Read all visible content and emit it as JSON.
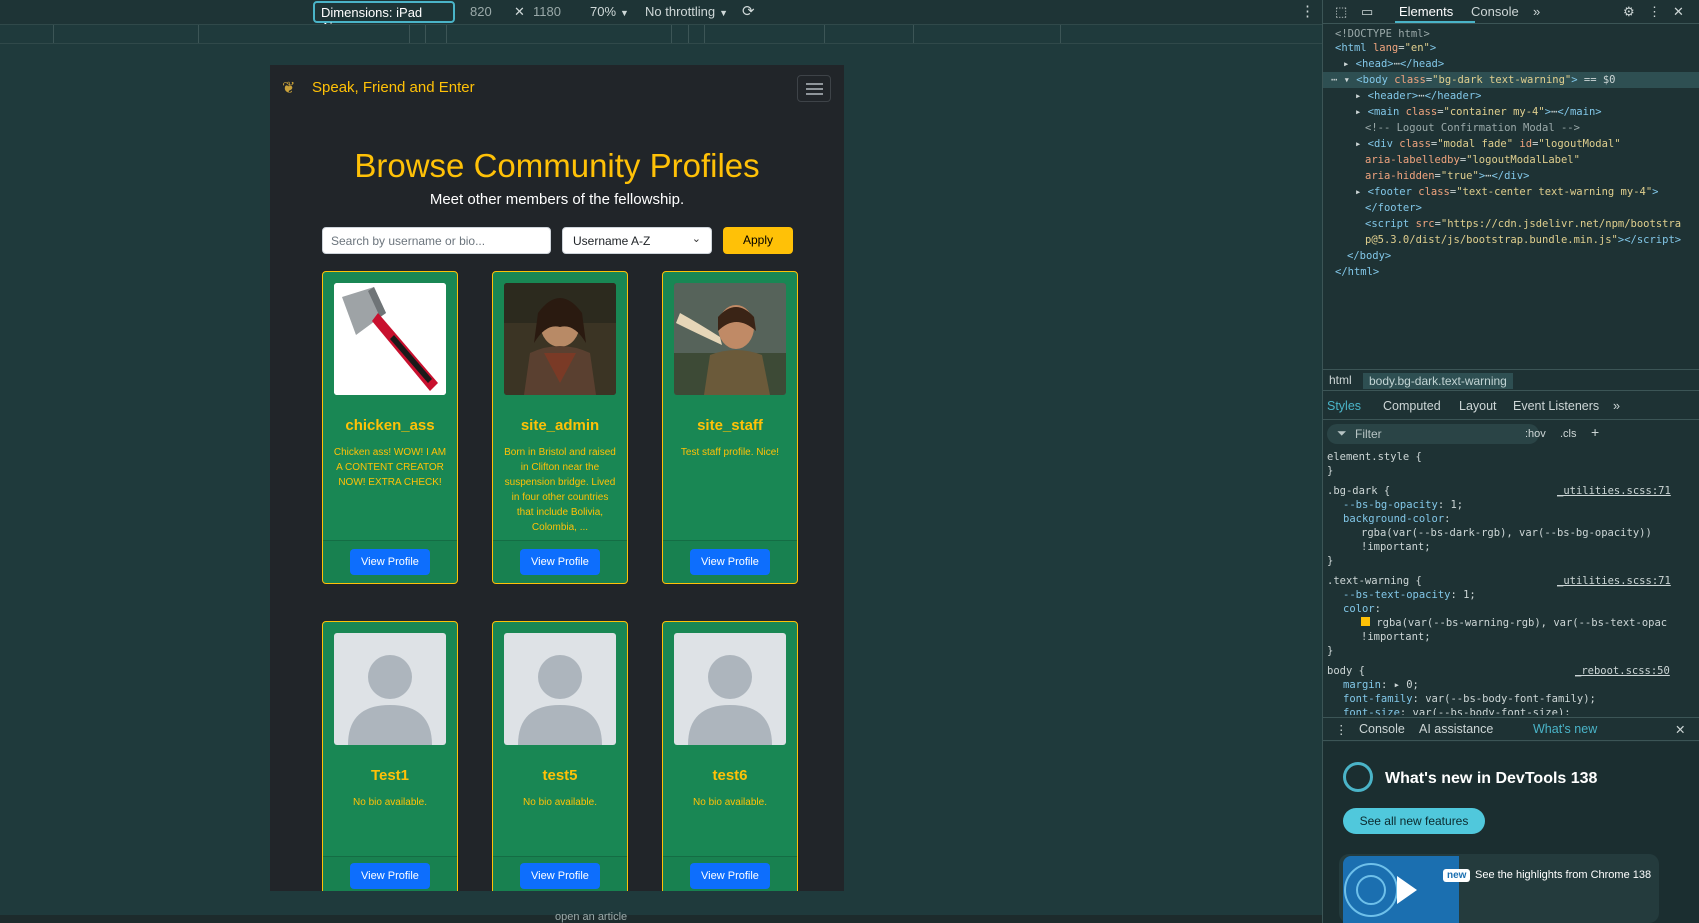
{
  "devtools_toolbar": {
    "dimensions": "Dimensions: iPad Air",
    "width": "820",
    "height": "1180",
    "zoom": "70%",
    "throttling": "No throttling"
  },
  "site": {
    "brand": "Speak, Friend and Enter",
    "title": "Browse Community Profiles",
    "subtitle": "Meet other members of the fellowship.",
    "search_placeholder": "Search by username or bio...",
    "sort_value": "Username A-Z",
    "apply_label": "Apply",
    "view_label": "View Profile",
    "profiles": [
      {
        "username": "chicken_ass",
        "bio": "Chicken ass! WOW! I AM A CONTENT CREATOR NOW! EXTRA CHECK!"
      },
      {
        "username": "site_admin",
        "bio": "Born in Bristol and raised in Clifton near the suspension bridge. Lived in four other countries that include Bolivia, Colombia, ..."
      },
      {
        "username": "site_staff",
        "bio": "Test staff profile. Nice!"
      },
      {
        "username": "Test1",
        "bio": "No bio available."
      },
      {
        "username": "test5",
        "bio": "No bio available."
      },
      {
        "username": "test6",
        "bio": "No bio available."
      }
    ]
  },
  "devtools": {
    "tabs": [
      "Elements",
      "Console"
    ],
    "breadcrumbs": [
      "html",
      "body.bg-dark.text-warning"
    ],
    "style_tabs": [
      "Styles",
      "Computed",
      "Layout",
      "Event Listeners"
    ],
    "filter_placeholder": "Filter",
    "filter_hov": ":hov",
    "filter_cls": ".cls",
    "drawer_tabs": [
      "Console",
      "AI assistance",
      "What's new"
    ],
    "whatsnew_title": "What's new in DevTools 138",
    "whatsnew_button": "See all new features",
    "whatsnew_card_text": "See the highlights from Chrome 138",
    "whatsnew_badge": "new",
    "bottom_peek": "open an article"
  },
  "colors": {
    "accent": "#ffc107",
    "card": "#198754",
    "button": "#0d6efd",
    "page_bg": "#212529"
  }
}
